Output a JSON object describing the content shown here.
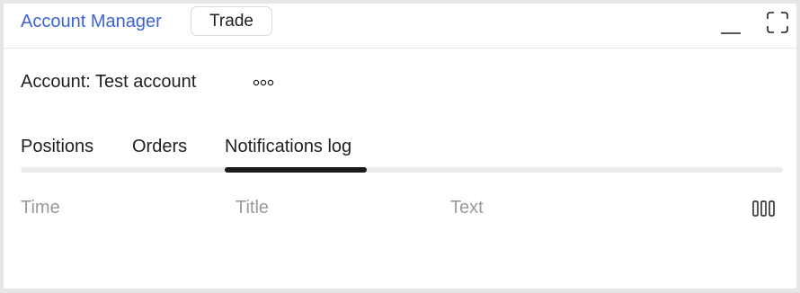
{
  "header": {
    "app_title": "Account Manager",
    "trade_label": "Trade",
    "icons": {
      "minimize": "minimize-icon",
      "maximize": "maximize-icon"
    }
  },
  "account": {
    "label": "Account: Test account",
    "more_icon": "more-horizontal-icon"
  },
  "tabs": [
    {
      "label": "Positions",
      "active": false
    },
    {
      "label": "Orders",
      "active": false
    },
    {
      "label": "Notifications log",
      "active": true
    }
  ],
  "table": {
    "columns": [
      "Time",
      "Title",
      "Text"
    ],
    "columns_settings_icon": "columns-icon",
    "rows": []
  },
  "colors": {
    "accent": "#3b63d6",
    "text": "#1f1f1f",
    "muted": "#9a9a9a",
    "active_indicator": "#1a1a1a"
  }
}
